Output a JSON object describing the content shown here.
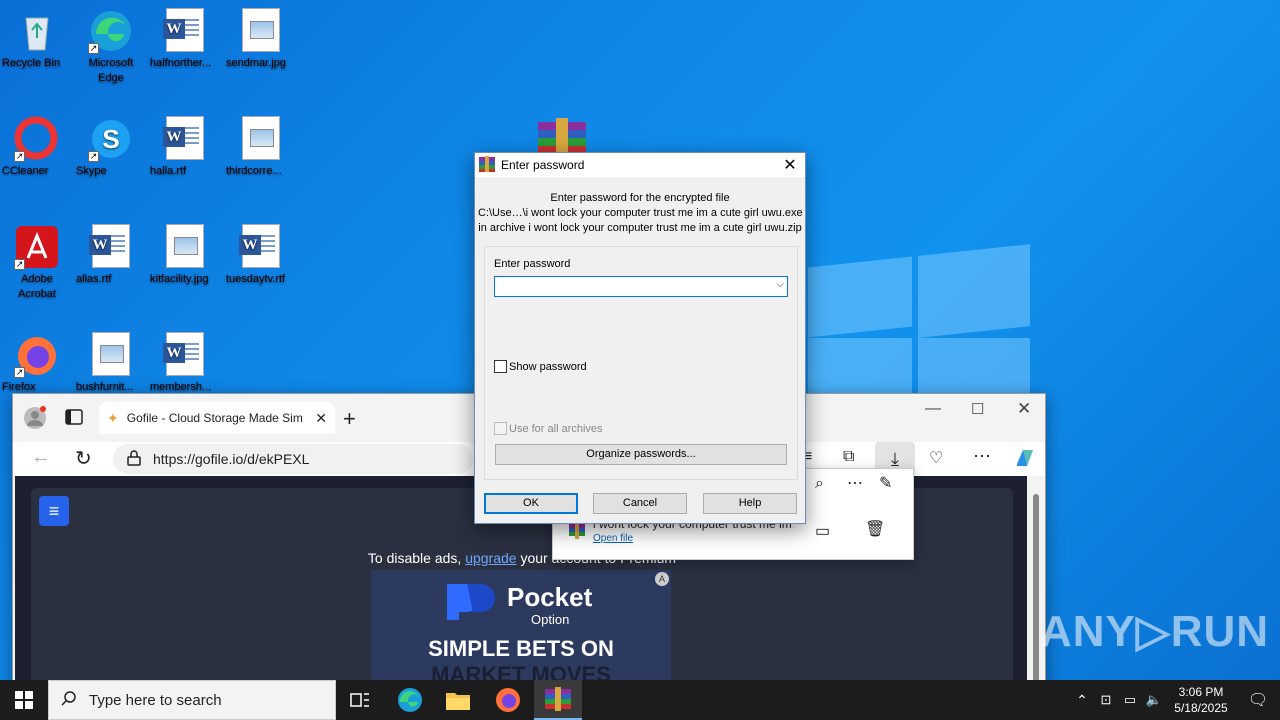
{
  "desktop": {
    "icons": [
      {
        "label": "Recycle Bin"
      },
      {
        "label": "Microsoft Edge"
      },
      {
        "label": "halfnorther..."
      },
      {
        "label": "sendmar.jpg"
      },
      {
        "label": "CCleaner"
      },
      {
        "label": "Skype"
      },
      {
        "label": "halla.rtf"
      },
      {
        "label": "thirdcorre..."
      },
      {
        "label": "Adobe Acrobat"
      },
      {
        "label": "allas.rtf"
      },
      {
        "label": "kitfacility.jpg"
      },
      {
        "label": "tuesdaytv.rtf"
      },
      {
        "label": "Firefox"
      },
      {
        "label": "bushfurnit..."
      },
      {
        "label": "membersh..."
      }
    ]
  },
  "browser": {
    "tab_title": "Gofile - Cloud Storage Made Sim",
    "url": "https://gofile.io/d/ekPEXL",
    "ad_notice_prefix": "To disable ads,",
    "ad_notice_link": "upgrade",
    "ad_notice_suffix": "your account to Premium",
    "ad_brand": "Pocket",
    "ad_brand_sub": "Option",
    "ad_headline": "SIMPLE BETS ON",
    "ad_headline2": "MARKET MOVES"
  },
  "downloads": {
    "file_name": "i wont lock your computer trust me im...",
    "open_file": "Open file"
  },
  "dialog": {
    "title": "Enter password",
    "info_line1": "Enter password for the encrypted file",
    "info_line2": "C:\\Use…\\i wont lock your computer trust me im a cute girl uwu.exe",
    "info_line3": "in archive i wont lock your computer trust me im a cute girl uwu.zip",
    "password_label": "Enter password",
    "password_value": "",
    "show_password": "Show password",
    "use_for_all": "Use for all archives",
    "organize": "Organize passwords...",
    "ok": "OK",
    "cancel": "Cancel",
    "help": "Help"
  },
  "taskbar": {
    "search_placeholder": "Type here to search",
    "time": "3:06 PM",
    "date": "5/18/2025"
  },
  "watermark": "ANY▷RUN"
}
